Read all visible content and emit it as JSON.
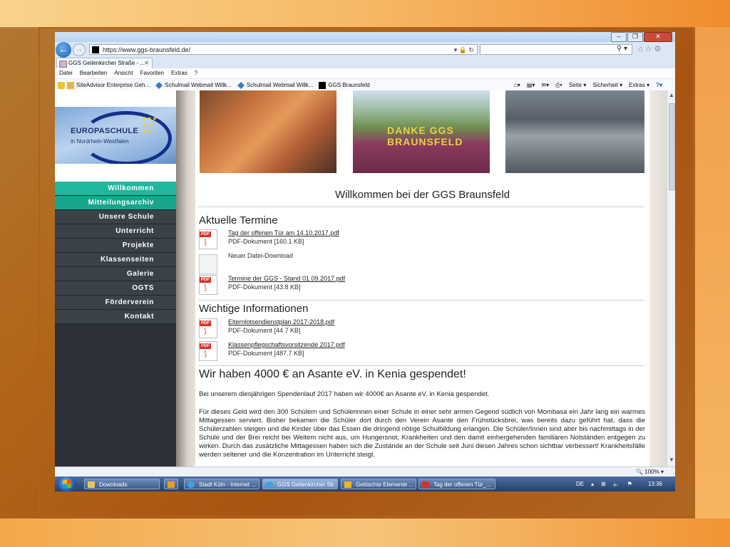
{
  "browser": {
    "address": "https://www.ggs-braunsfeld.de/",
    "tab_label": "GGS Geilenkircher Straße - ...",
    "menu": [
      "Datei",
      "Bearbeiten",
      "Ansicht",
      "Favoriten",
      "Extras",
      "?"
    ],
    "favorites": [
      "SiteAdvisor Enterprise Geh...",
      "Schulmail Webmail  Willk...",
      "Schulmail Webmail  Willk...",
      "GGS Braunsfeld"
    ],
    "right_tools": [
      "Seite ▾",
      "Sicherheit ▾",
      "Extras ▾"
    ],
    "zoom": "100%"
  },
  "site": {
    "logo_title": "EUROPASCHULE",
    "logo_subtitle": "in Nordrhein-Westfalen",
    "nav": [
      "Willkommen",
      "Mitteilungsarchiv",
      "Unsere Schule",
      "Unterricht",
      "Projekte",
      "Klassenseiten",
      "Galerie",
      "OGTS",
      "Förderverein",
      "Kontakt"
    ],
    "photo_overlay": "DANKE GGS BRAUNSFELD",
    "welcome": "Willkommen bei der GGS Braunsfeld",
    "section_termine": "Aktuelle Termine",
    "termine": [
      {
        "name": "Tag der offenen Tür am 14.10.2017.pdf",
        "meta": "PDF-Dokument [160.1 KB]"
      },
      {
        "name": "Neuer Datei-Download"
      },
      {
        "name": "Termine der GGS - Stand 01.09.2017.pdf",
        "meta": "PDF-Dokument [43.8 KB]"
      }
    ],
    "section_info": "Wichtige Informationen",
    "infos": [
      {
        "name": "Elternlotsendienstplan 2017-2018.pdf",
        "meta": "PDF-Dokument [44.7 KB]"
      },
      {
        "name": "Klassenpflegschaftsvorsitzende 2017.pdf",
        "meta": "PDF-Dokument [487.7 KB]"
      }
    ],
    "news_title": "Wir haben 4000 € an Asante eV. in Kenia gespendet!",
    "news_p1": "Bei unserem diesjährigen Spendenlauf 2017 haben wir 4000€ an Asante eV. in Kenia gespendet.",
    "news_p2": "Für dieses Geld wird den 300 Schülern und Schülerinnen einer Schule in einer sehr armen Gegend südlich von Mombasa ein Jahr lang ein warmes Mittagessen serviert. Bisher bekamen die Schüler dort durch den Verein Asante den Frühstücksbrei, was bereits dazu geführt hat, dass die Schülerzahlen steigen und die Kinder über das Essen die dringend nötige Schulbildung erlangen. Die Schüler/Innen sind aber bis nachmittags in der Schule und der Brei reicht bei Weitem nicht aus, um Hungersnot, Krankheiten und den damit einhergehenden familiären Notständen entgegen zu wirken. Durch das zusätzliche Mittagessen haben sich die Zustände an der Schule seit Juni diesen Jahres schon sichtbar verbessert! Krankheitsfälle werden seltener und die Konzentration im Unterricht steigt."
  },
  "taskbar": {
    "items": [
      "Downloads",
      "",
      "Stadt Köln - Internet ...",
      "GGS Geilenkircher Str...",
      "Gelöschte Elemente ...",
      "Tag der offenen Tür_..."
    ],
    "lang": "DE",
    "time": "13:36"
  }
}
